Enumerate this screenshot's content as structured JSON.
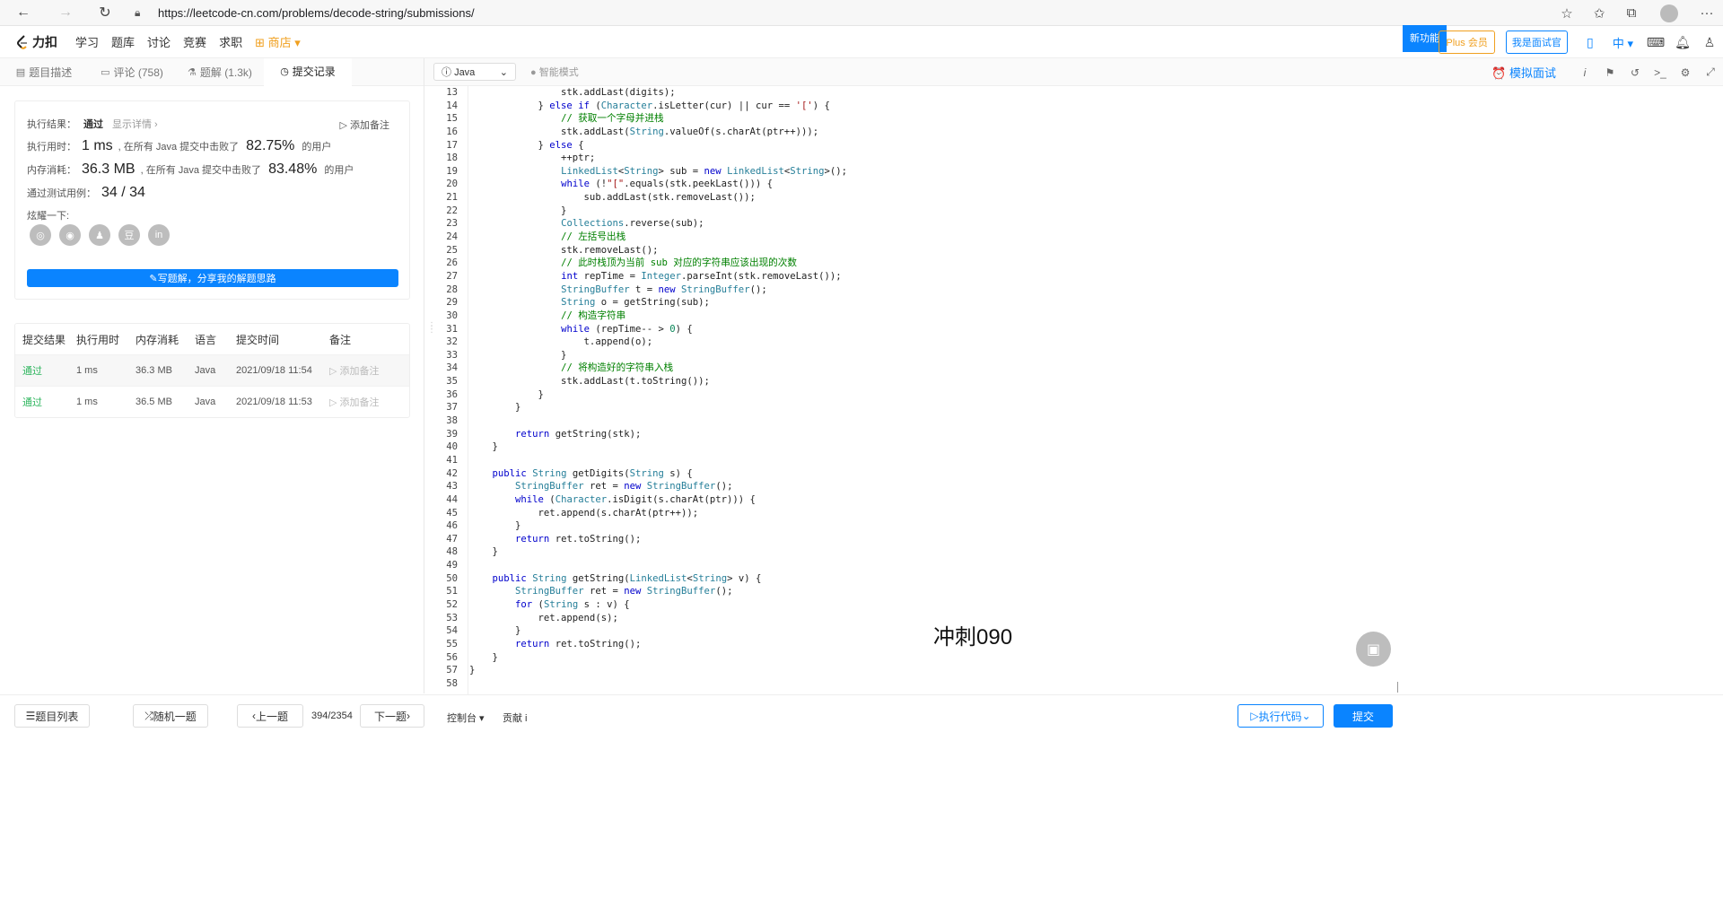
{
  "browser": {
    "url": "https://leetcode-cn.com/problems/decode-string/submissions/"
  },
  "header": {
    "logo_text": "力扣",
    "menu": [
      "学习",
      "题库",
      "讨论",
      "竞赛",
      "求职",
      "商店"
    ],
    "new_feature": "新功能",
    "plus_label": "Plus 会员",
    "interviewer_label": "我是面试官",
    "lang": "中"
  },
  "left_tabs": [
    {
      "label": "题目描述"
    },
    {
      "label": "评论 (758)"
    },
    {
      "label": "题解 (1.3k)"
    },
    {
      "label": "提交记录"
    }
  ],
  "result": {
    "status_label": "执行结果：",
    "status": "通过",
    "detail_link": "显示详情 ›",
    "add_note": "添加备注",
    "runtime_label": "执行用时：",
    "runtime": "1 ms",
    "runtime_mid": ", 在所有 Java 提交中击败了",
    "runtime_pct": "82.75%",
    "runtime_tail": "的用户",
    "memory_label": "内存消耗：",
    "memory": "36.3 MB",
    "memory_mid": ", 在所有 Java 提交中击败了",
    "memory_pct": "83.48%",
    "memory_tail": "的用户",
    "tests_label": "通过测试用例：",
    "tests": "34 / 34",
    "share_label": "炫耀一下:",
    "write_btn": "写题解，分享我的解题思路"
  },
  "submissions": {
    "headers": [
      "提交结果",
      "执行用时",
      "内存消耗",
      "语言",
      "提交时间",
      "备注"
    ],
    "rows": [
      {
        "status": "通过",
        "runtime": "1 ms",
        "memory": "36.3 MB",
        "lang": "Java",
        "time": "2021/09/18 11:54",
        "note": "添加备注"
      },
      {
        "status": "通过",
        "runtime": "1 ms",
        "memory": "36.5 MB",
        "lang": "Java",
        "time": "2021/09/18 11:53",
        "note": "添加备注"
      }
    ]
  },
  "editor": {
    "language": "Java",
    "smart_mode": "智能模式",
    "mock_interview": "模拟面试",
    "watermark": "冲刺090",
    "code": [
      {
        "n": "13",
        "t": "                stk.addLast(digits);"
      },
      {
        "n": "14",
        "t": "            } else if (Character.isLetter(cur) || cur == '[') {"
      },
      {
        "n": "15",
        "t": "                // 获取一个字母并进栈"
      },
      {
        "n": "16",
        "t": "                stk.addLast(String.valueOf(s.charAt(ptr++)));"
      },
      {
        "n": "17",
        "t": "            } else {"
      },
      {
        "n": "18",
        "t": "                ++ptr;"
      },
      {
        "n": "19",
        "t": "                LinkedList<String> sub = new LinkedList<String>();"
      },
      {
        "n": "20",
        "t": "                while (!\"[\".equals(stk.peekLast())) {"
      },
      {
        "n": "21",
        "t": "                    sub.addLast(stk.removeLast());"
      },
      {
        "n": "22",
        "t": "                }"
      },
      {
        "n": "23",
        "t": "                Collections.reverse(sub);"
      },
      {
        "n": "24",
        "t": "                // 左括号出栈"
      },
      {
        "n": "25",
        "t": "                stk.removeLast();"
      },
      {
        "n": "26",
        "t": "                // 此时栈顶为当前 sub 对应的字符串应该出现的次数"
      },
      {
        "n": "27",
        "t": "                int repTime = Integer.parseInt(stk.removeLast());"
      },
      {
        "n": "28",
        "t": "                StringBuffer t = new StringBuffer();"
      },
      {
        "n": "29",
        "t": "                String o = getString(sub);"
      },
      {
        "n": "30",
        "t": "                // 构造字符串"
      },
      {
        "n": "31",
        "t": "                while (repTime-- > 0) {"
      },
      {
        "n": "32",
        "t": "                    t.append(o);"
      },
      {
        "n": "33",
        "t": "                }"
      },
      {
        "n": "34",
        "t": "                // 将构造好的字符串入栈"
      },
      {
        "n": "35",
        "t": "                stk.addLast(t.toString());"
      },
      {
        "n": "36",
        "t": "            }"
      },
      {
        "n": "37",
        "t": "        }"
      },
      {
        "n": "38",
        "t": ""
      },
      {
        "n": "39",
        "t": "        return getString(stk);"
      },
      {
        "n": "40",
        "t": "    }"
      },
      {
        "n": "41",
        "t": ""
      },
      {
        "n": "42",
        "t": "    public String getDigits(String s) {"
      },
      {
        "n": "43",
        "t": "        StringBuffer ret = new StringBuffer();"
      },
      {
        "n": "44",
        "t": "        while (Character.isDigit(s.charAt(ptr))) {"
      },
      {
        "n": "45",
        "t": "            ret.append(s.charAt(ptr++));"
      },
      {
        "n": "46",
        "t": "        }"
      },
      {
        "n": "47",
        "t": "        return ret.toString();"
      },
      {
        "n": "48",
        "t": "    }"
      },
      {
        "n": "49",
        "t": ""
      },
      {
        "n": "50",
        "t": "    public String getString(LinkedList<String> v) {"
      },
      {
        "n": "51",
        "t": "        StringBuffer ret = new StringBuffer();"
      },
      {
        "n": "52",
        "t": "        for (String s : v) {"
      },
      {
        "n": "53",
        "t": "            ret.append(s);"
      },
      {
        "n": "54",
        "t": "        }"
      },
      {
        "n": "55",
        "t": "        return ret.toString();"
      },
      {
        "n": "56",
        "t": "    }"
      },
      {
        "n": "57",
        "t": "}"
      },
      {
        "n": "58",
        "t": ""
      }
    ]
  },
  "footer": {
    "problem_list": "题目列表",
    "random": "随机一题",
    "prev": "上一题",
    "counter": "394/2354",
    "next": "下一题",
    "console": "控制台",
    "contribute": "贡献 i",
    "run": "执行代码",
    "submit": "提交"
  }
}
